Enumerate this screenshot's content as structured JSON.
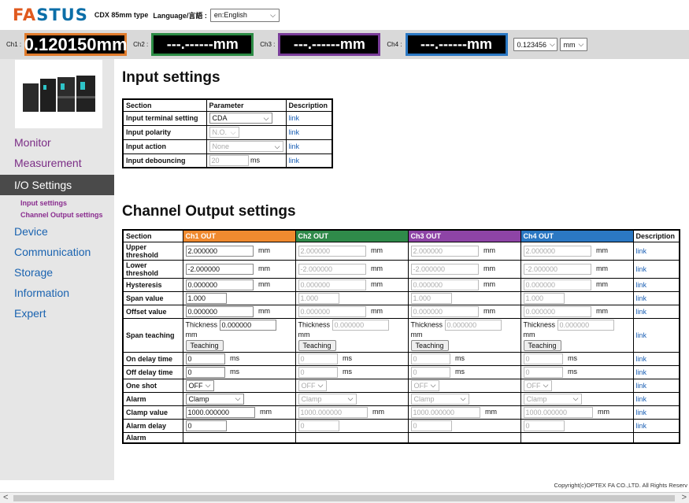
{
  "header": {
    "logo": "FASTUS",
    "model": "CDX 85mm type",
    "language_label": "Language/言語 :",
    "language_value": "en:English"
  },
  "channels": [
    {
      "label": "Ch1 :",
      "value": "0.120150mm"
    },
    {
      "label": "Ch2 :",
      "value": "---.------mm"
    },
    {
      "label": "Ch3 :",
      "value": "---.------mm"
    },
    {
      "label": "Ch4 :",
      "value": "---.------mm"
    }
  ],
  "resolution": "0.123456",
  "unit": "mm",
  "sidebar": {
    "items": [
      {
        "label": "Monitor"
      },
      {
        "label": "Measurement"
      },
      {
        "label": "I/O Settings"
      }
    ],
    "sub": [
      "Input settings",
      "Channel Output settings"
    ],
    "items2": [
      {
        "label": "Device"
      },
      {
        "label": "Communication"
      },
      {
        "label": "Storage"
      },
      {
        "label": "Information"
      },
      {
        "label": "Expert"
      }
    ]
  },
  "input": {
    "title": "Input settings",
    "headers": [
      "Section",
      "Parameter",
      "Description"
    ],
    "rows": [
      {
        "label": "Input terminal setting",
        "value": "CDA",
        "link": "link"
      },
      {
        "label": "Input polarity",
        "value": "N.O.",
        "link": "link"
      },
      {
        "label": "Input action",
        "value": "None",
        "link": "link"
      },
      {
        "label": "Input debouncing",
        "value": "20",
        "unit": "ms",
        "link": "link"
      }
    ]
  },
  "output": {
    "title": "Channel Output settings",
    "headers": [
      "Section",
      "Ch1 OUT",
      "Ch2 OUT",
      "Ch3 OUT",
      "Ch4 OUT",
      "Description"
    ],
    "rows": [
      {
        "label": "Upper threshold",
        "value": "2.000000",
        "unit": "mm"
      },
      {
        "label": "Lower threshold",
        "value": "-2.000000",
        "unit": "mm"
      },
      {
        "label": "Hysteresis",
        "value": "0.000000",
        "unit": "mm"
      },
      {
        "label": "Span value",
        "value": "1.000",
        "unit": ""
      },
      {
        "label": "Offset value",
        "value": "0.000000",
        "unit": "mm"
      },
      {
        "label": "Span teaching",
        "value": "0.000000",
        "unit": "mm"
      },
      {
        "label": "On delay time",
        "value": "0",
        "unit": "ms"
      },
      {
        "label": "Off delay time",
        "value": "0",
        "unit": "ms"
      },
      {
        "label": "One shot",
        "value": "OFF",
        "unit": ""
      },
      {
        "label": "Alarm",
        "value": "Clamp",
        "unit": ""
      },
      {
        "label": "Clamp value",
        "value": "1000.000000",
        "unit": "mm"
      },
      {
        "label": "Alarm delay",
        "value": "0",
        "unit": ""
      }
    ],
    "link": "link",
    "thickness_label": "Thickness",
    "teaching_label": "Teaching",
    "partial_row_label": "Alarm"
  },
  "footer": {
    "copyright": "Copyright(c)OPTEX FA CO.,LTD. All Rights Reserv"
  }
}
